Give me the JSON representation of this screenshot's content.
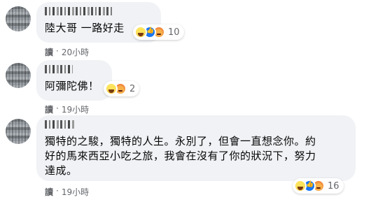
{
  "comments": [
    {
      "text": "陸大哥 一路好走",
      "reactions": {
        "types": [
          "haha-icon",
          "like-icon",
          "angry-icon"
        ],
        "count": "10"
      },
      "meta": {
        "read": "讀",
        "dot": "·",
        "time": "20小時"
      }
    },
    {
      "text": "阿彌陀佛！",
      "reactions": {
        "types": [
          "haha-icon",
          "angry-icon"
        ],
        "count": "2"
      },
      "meta": {
        "read": "讀",
        "dot": "·",
        "time": "19小時"
      }
    },
    {
      "text_lines": [
        "獨特的之駿，獨特的人生。永別了，但會一直想念你。約",
        "好的馬來西亞小吃之旅，我會在沒有了你的狀況下，努力",
        "達成。"
      ],
      "reactions": {
        "types": [
          "haha-icon",
          "like-icon",
          "angry-icon"
        ],
        "count": "16"
      },
      "meta": {
        "read": "讀",
        "dot": "·",
        "time": "19小時"
      }
    }
  ],
  "colors": {
    "bubble": "#f0f2f5",
    "meta_text": "#65676b",
    "like_blue": "#1877f2"
  }
}
